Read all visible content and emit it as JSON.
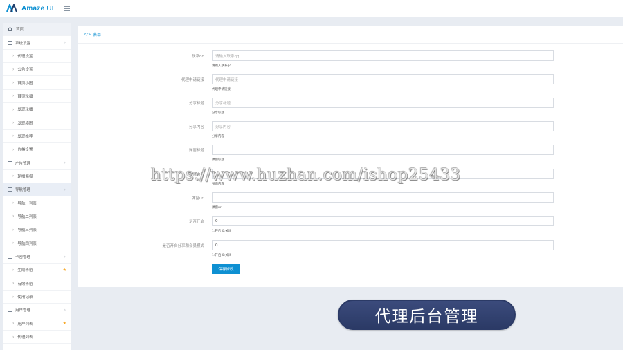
{
  "brand": {
    "name": "Amaze",
    "suffix": "UI",
    "accent": "#0e90d2"
  },
  "sidebar": {
    "items": [
      {
        "label": "首页",
        "type": "home",
        "icon": "home-icon"
      },
      {
        "label": "系统设置",
        "type": "parent",
        "icon": "panel-icon",
        "arrow": "›"
      },
      {
        "label": "代理设置",
        "type": "child"
      },
      {
        "label": "公告设置",
        "type": "child"
      },
      {
        "label": "首页小图",
        "type": "child"
      },
      {
        "label": "首页轮播",
        "type": "child"
      },
      {
        "label": "发现轮播",
        "type": "child"
      },
      {
        "label": "发现横图",
        "type": "child"
      },
      {
        "label": "发现推荐",
        "type": "child"
      },
      {
        "label": "价格设置",
        "type": "child"
      },
      {
        "label": "广告管理",
        "type": "parent",
        "icon": "panel-icon",
        "arrow": "›"
      },
      {
        "label": "轮播海报",
        "type": "child"
      },
      {
        "label": "导航管理",
        "type": "parent",
        "icon": "panel-icon",
        "arrow": "›",
        "active": true
      },
      {
        "label": "导航一列表",
        "type": "child"
      },
      {
        "label": "导航二列表",
        "type": "child"
      },
      {
        "label": "导航三列表",
        "type": "child"
      },
      {
        "label": "导航四列表",
        "type": "child"
      },
      {
        "label": "卡密管理",
        "type": "parent",
        "icon": "panel-icon",
        "arrow": "›"
      },
      {
        "label": "生成卡密",
        "type": "child",
        "star": "★"
      },
      {
        "label": "有效卡密",
        "type": "child"
      },
      {
        "label": "使用记录",
        "type": "child"
      },
      {
        "label": "用户管理",
        "type": "parent",
        "icon": "panel-icon",
        "arrow": "›"
      },
      {
        "label": "用户列表",
        "type": "child",
        "star": "★"
      },
      {
        "label": "代理列表",
        "type": "child"
      }
    ]
  },
  "panel": {
    "code_icon": "</>",
    "title": "表单",
    "fields": [
      {
        "label": "联系qq",
        "placeholder": "请输入联系qq",
        "value": "",
        "hint": "请输入联系qq"
      },
      {
        "label": "代理申请链接",
        "placeholder": "代理申请链接",
        "value": "",
        "hint": "代理申请链接"
      },
      {
        "label": "分享标题",
        "placeholder": "分享标题",
        "value": "",
        "hint": "分享标题"
      },
      {
        "label": "分享内容",
        "placeholder": "分享内容",
        "value": "",
        "hint": "分享内容"
      },
      {
        "label": "弹窗标题",
        "placeholder": "",
        "value": "",
        "hint": "弹窗标题"
      },
      {
        "label": "弹窗内容",
        "placeholder": "",
        "value": "",
        "hint": "弹窗内容"
      },
      {
        "label": "弹窗url",
        "placeholder": "",
        "value": "",
        "hint": "弹窗url"
      },
      {
        "label": "是否开启",
        "placeholder": "",
        "value": "0",
        "hint": "1:开启 0:关闭"
      },
      {
        "label": "是否开启分享和会员模式",
        "placeholder": "",
        "value": "0",
        "hint": "1:开启 0:关闭"
      }
    ],
    "save_label": "保存修改"
  },
  "watermark": "https://www.huzhan.com/ishop25433",
  "banner": "代理后台管理"
}
